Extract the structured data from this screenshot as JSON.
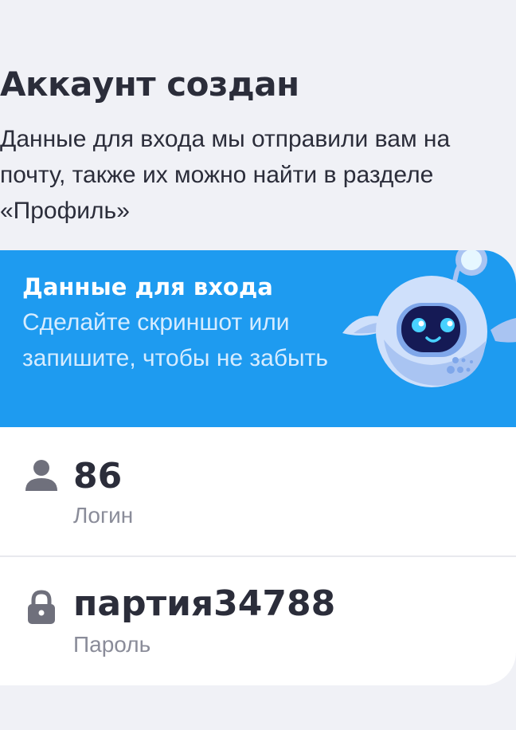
{
  "header": {
    "title": "Аккаунт создан",
    "description": "Данные для входа мы отправили вам на почту, также их можно найти в разделе «Профиль»"
  },
  "banner": {
    "title": "Данные для входа",
    "text": "Сделайте скриншот или запишите, чтобы не забыть",
    "icon": "robot-mascot-icon"
  },
  "credentials": {
    "login": {
      "icon": "user-icon",
      "value": "86",
      "label": "Логин"
    },
    "password": {
      "icon": "lock-icon",
      "value": "партия34788",
      "label": "Пароль"
    }
  },
  "colors": {
    "background": "#f0f1f6",
    "banner": "#1e9bf0",
    "text_primary": "#2b2d3a",
    "text_secondary": "#8a8c99"
  }
}
